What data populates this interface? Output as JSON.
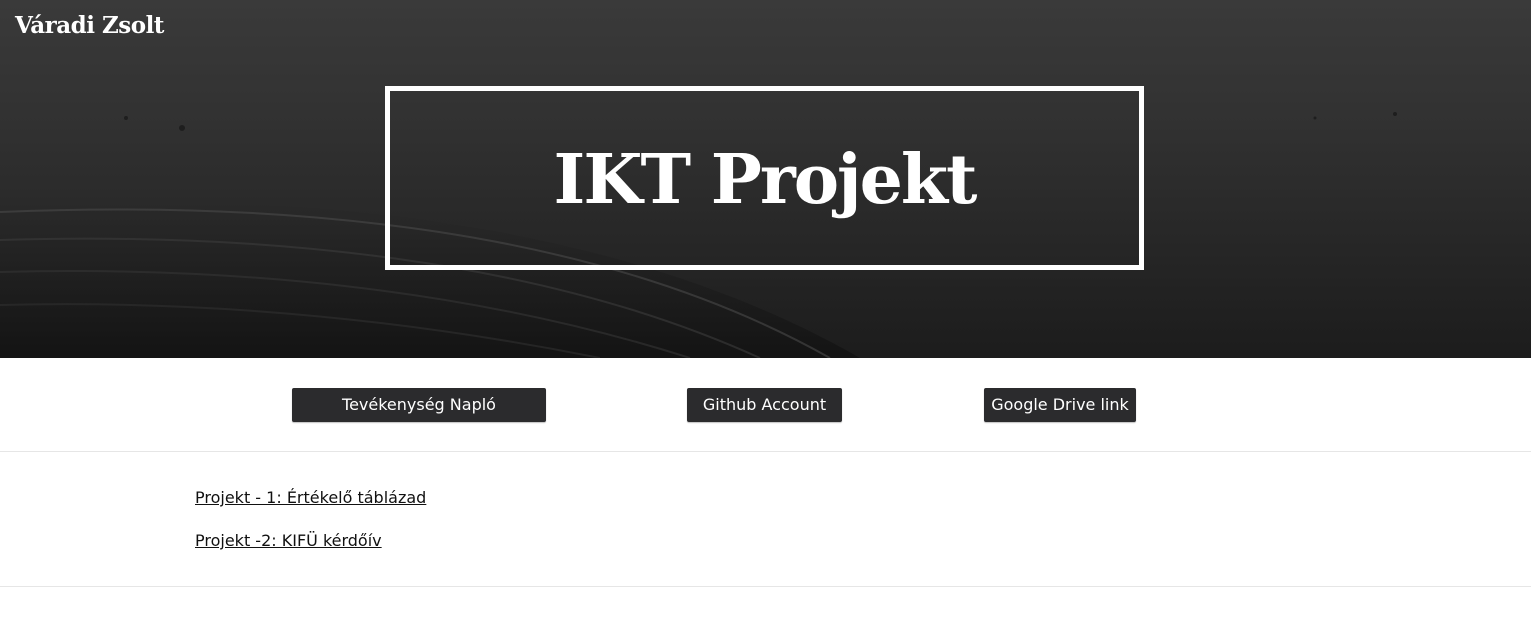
{
  "header": {
    "site_title": "Váradi Zsolt",
    "hero_title": "IKT Projekt"
  },
  "buttons": {
    "activity_log": "Tevékenység Napló",
    "github": "Github Account",
    "google_drive": "Google Drive link"
  },
  "projects": [
    {
      "label": "Projekt - 1: Értékelő táblázad"
    },
    {
      "label": "Projekt -2: KIFÜ kérdőív"
    }
  ],
  "colors": {
    "hero_dark": "#2e2e2e",
    "button_bg": "#2b2b2d",
    "text_light": "#ffffff",
    "link_text": "#111111",
    "divider": "#e6e6e6"
  }
}
